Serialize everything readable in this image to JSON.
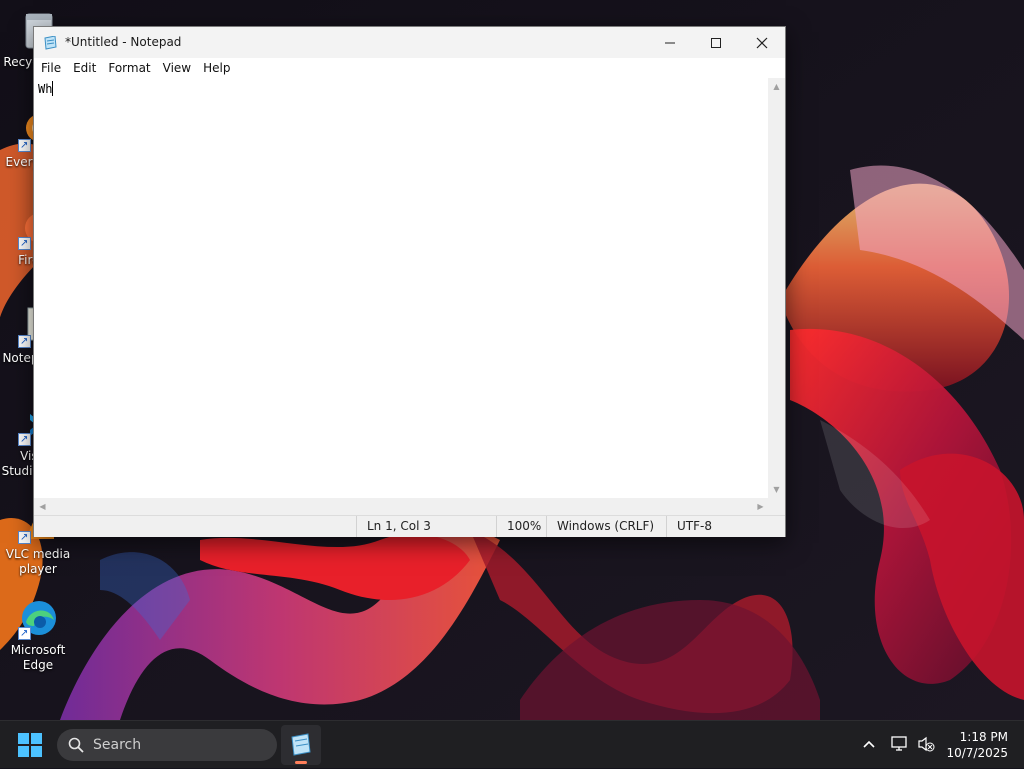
{
  "desktop": {
    "icons": [
      {
        "label": "Recycle Bin",
        "icon": "recycle-bin-icon"
      },
      {
        "label": "Everything",
        "icon": "everything-icon"
      },
      {
        "label": "Firefox",
        "icon": "firefox-icon"
      },
      {
        "label": "Notepad++",
        "icon": "notepad-plus-plus-icon"
      },
      {
        "label": "Visual Studio Code",
        "icon": "vscode-icon"
      },
      {
        "label": "VLC media player",
        "icon": "vlc-icon"
      },
      {
        "label": "Microsoft Edge",
        "icon": "edge-icon"
      }
    ]
  },
  "window": {
    "title": "*Untitled - Notepad",
    "app_icon": "notepad-icon",
    "controls": {
      "minimize": "minimize-icon",
      "maximize": "maximize-icon",
      "close": "close-icon"
    },
    "menu": [
      "File",
      "Edit",
      "Format",
      "View",
      "Help"
    ],
    "editor": {
      "content": "Wh"
    },
    "status": {
      "position": "Ln 1, Col 3",
      "zoom": "100%",
      "line_ending": "Windows (CRLF)",
      "encoding": "UTF-8"
    }
  },
  "taskbar": {
    "start_icon": "windows-start-icon",
    "search_placeholder": "Search",
    "pinned_app_icon": "notepad-icon",
    "tray": {
      "chevron": "chevron-up-icon",
      "network": "network-icon",
      "volume": "volume-muted-icon"
    },
    "time": "1:18 PM",
    "date": "10/7/2025"
  },
  "colors": {
    "accent": "#ff7f5a",
    "start": "#4cc2ff",
    "taskbar": "#1f1f22"
  }
}
